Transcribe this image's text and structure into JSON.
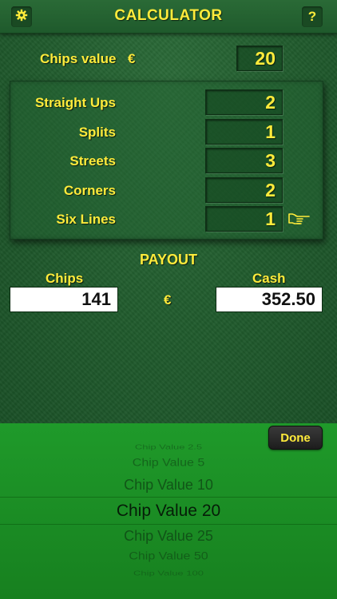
{
  "header": {
    "title": "CALCULATOR",
    "settings_icon": "gear-icon",
    "help_label": "?"
  },
  "chips_value": {
    "label": "Chips value",
    "currency": "€",
    "value": "20"
  },
  "bets": [
    {
      "label": "Straight Ups",
      "value": "2"
    },
    {
      "label": "Splits",
      "value": "1"
    },
    {
      "label": "Streets",
      "value": "3"
    },
    {
      "label": "Corners",
      "value": "2"
    },
    {
      "label": "Six Lines",
      "value": "1"
    }
  ],
  "pointer_icon": "pointing-hand-icon",
  "payout": {
    "title": "PAYOUT",
    "chips_label": "Chips",
    "cash_label": "Cash",
    "currency": "€",
    "chips_value": "141",
    "cash_value": "352.50"
  },
  "picker": {
    "done_label": "Done",
    "items": [
      "Chip Value 2.5",
      "Chip Value 5",
      "Chip Value 10",
      "Chip Value 20",
      "Chip Value 25",
      "Chip Value 50",
      "Chip Value 100"
    ],
    "selected": "Chip Value 20"
  }
}
